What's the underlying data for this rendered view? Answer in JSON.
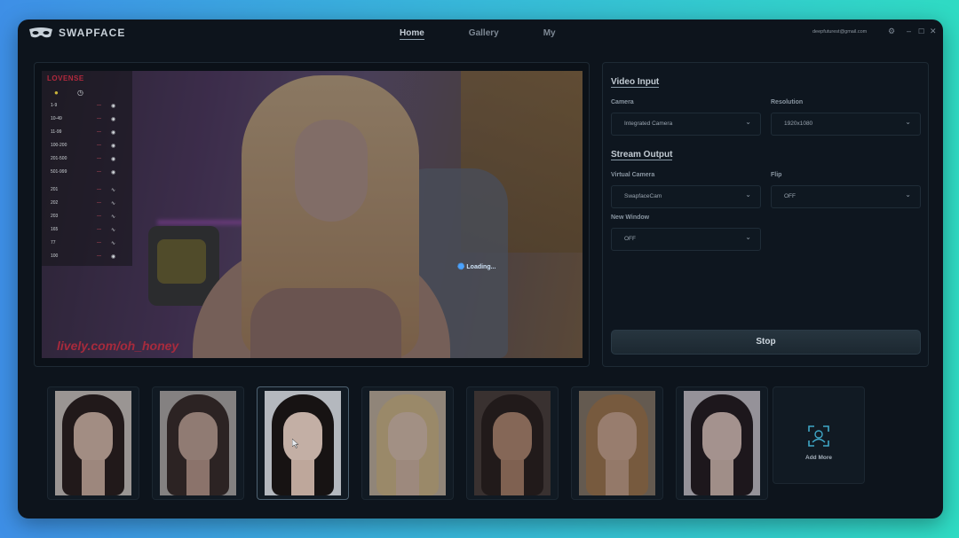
{
  "app": {
    "name": "SWAPFACE",
    "account": "deepfuturest@gmail.com"
  },
  "nav": {
    "items": [
      {
        "label": "Home",
        "active": true
      },
      {
        "label": "Gallery",
        "active": false
      },
      {
        "label": "My",
        "active": false
      }
    ]
  },
  "window_controls": {
    "settings_icon": "gear-icon",
    "minimize_icon": "minimize-icon",
    "maximize_icon": "maximize-icon",
    "close_icon": "close-icon"
  },
  "video": {
    "menu_header": "LOVENSE",
    "menu_rows": [
      {
        "label": "1-9",
        "icon": "circle-icon"
      },
      {
        "label": "10-49",
        "icon": "circle-icon"
      },
      {
        "label": "11-99",
        "icon": "circle-icon"
      },
      {
        "label": "100-200",
        "icon": "circle-icon"
      },
      {
        "label": "201-500",
        "icon": "circle-icon"
      },
      {
        "label": "501-999",
        "icon": "circle-icon"
      },
      {
        "label": "201",
        "icon": "wave-icon"
      },
      {
        "label": "202",
        "icon": "wave-icon"
      },
      {
        "label": "203",
        "icon": "wave-icon"
      },
      {
        "label": "165",
        "icon": "wave-icon"
      },
      {
        "label": "77",
        "icon": "wave-icon"
      },
      {
        "label": "100",
        "icon": "circle-icon"
      }
    ],
    "watermark": "lively.com/oh_honey",
    "loading_text": "Loading..."
  },
  "settings": {
    "video_input_title": "Video Input",
    "camera_label": "Camera",
    "camera_value": "Integrated Camera",
    "resolution_label": "Resolution",
    "resolution_value": "1920x1080",
    "stream_output_title": "Stream Output",
    "virtual_camera_label": "Virtual Camera",
    "virtual_camera_value": "SwapfaceCam",
    "flip_label": "Flip",
    "flip_value": "OFF",
    "new_window_label": "New Window",
    "new_window_value": "OFF",
    "stop_label": "Stop"
  },
  "faces": {
    "count": 7,
    "selected_index": 2,
    "add_more_label": "Add More"
  },
  "colors": {
    "background_gradient_start": "#3e8fe6",
    "background_gradient_end": "#2fdbc3",
    "window_bg": "#0d141c",
    "accent_red": "#b42b3c"
  }
}
